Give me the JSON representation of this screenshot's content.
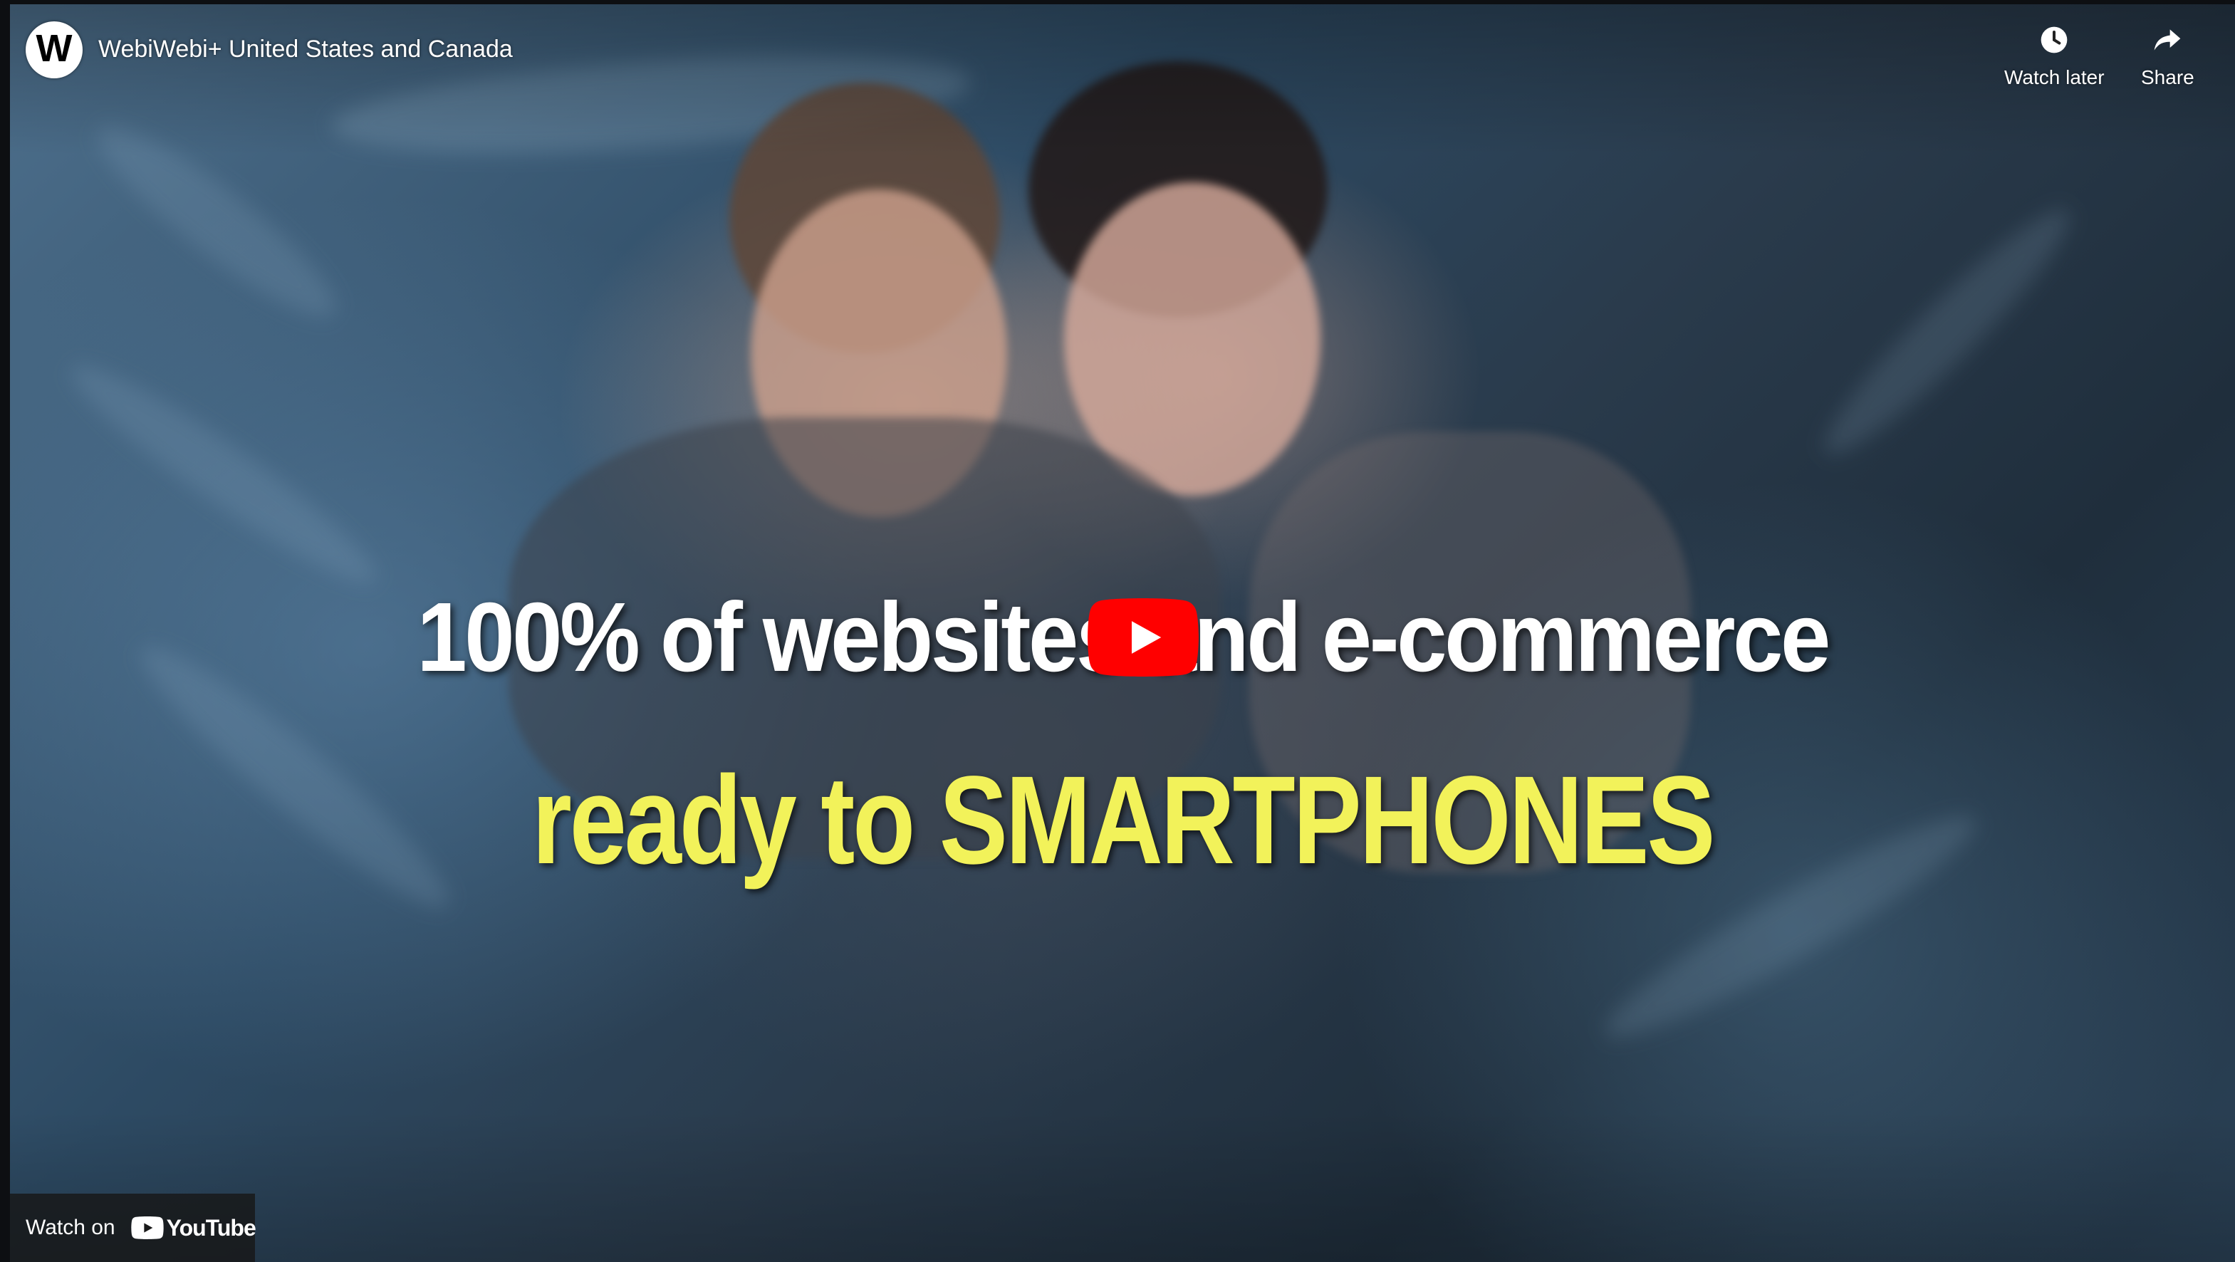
{
  "header": {
    "channel_logo_letter": "W",
    "title": "WebiWebi+ United States and Canada"
  },
  "actions": {
    "watch_later_label": "Watch later",
    "share_label": "Share"
  },
  "thumbnail": {
    "caption_line_1": "100% of websites and e-commerce",
    "caption_line_2": "ready to SMARTPHONES"
  },
  "play_button": {
    "icon": "play-icon",
    "color": "#ff0000"
  },
  "footer": {
    "watch_on_label": "Watch on",
    "brand_label": "YouTube"
  },
  "colors": {
    "caption_1": "#ffffff",
    "caption_2": "#f2f25a",
    "youtube_red": "#ff0000"
  }
}
